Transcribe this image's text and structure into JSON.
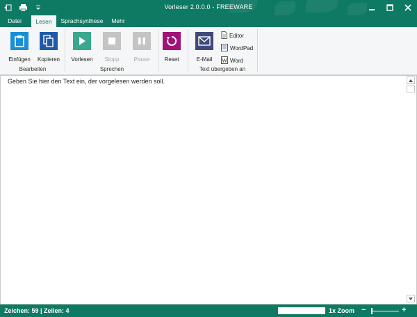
{
  "window": {
    "title": "Vorleser 2.0.0.0   -   FREEWARE",
    "minimize_icon": "minimize-icon",
    "maximize_icon": "maximize-icon",
    "close_icon": "close-icon"
  },
  "quick_access": [
    "back-icon",
    "printer-icon",
    "qat-dropdown-icon"
  ],
  "tabs": [
    {
      "label": "Datei",
      "active": false
    },
    {
      "label": "Lesen",
      "active": true
    },
    {
      "label": "Sprachsynthese",
      "active": false
    },
    {
      "label": "Mehr",
      "active": false
    }
  ],
  "ribbon": {
    "groups": {
      "bearbeiten": "Bearbeiten",
      "sprechen": "Sprechen",
      "uebergeben": "Text übergeben an"
    },
    "buttons": {
      "einfuegen": {
        "label": "Einfügen",
        "icon": "clipboard-icon",
        "color": "#1a8fd6"
      },
      "kopieren": {
        "label": "Kopieren",
        "icon": "copy-icon",
        "color": "#1f5aa8"
      },
      "vorlesen": {
        "label": "Vorlesen",
        "icon": "play-icon",
        "color": "#3aa88c"
      },
      "stopp": {
        "label": "Stopp",
        "icon": "stop-icon",
        "color": "#c4c4c4",
        "disabled": true
      },
      "pause": {
        "label": "Pause",
        "icon": "pause-icon",
        "color": "#c4c4c4",
        "disabled": true
      },
      "reset": {
        "label": "Reset",
        "icon": "reset-icon",
        "color": "#a0127a"
      },
      "email": {
        "label": "E-Mail",
        "icon": "envelope-icon",
        "color": "#3f4a7a"
      }
    },
    "small_buttons": {
      "editor": {
        "label": "Editor",
        "icon": "document-icon"
      },
      "wordpad": {
        "label": "WordPad",
        "icon": "wordpad-icon"
      },
      "word": {
        "label": "Word",
        "icon": "word-icon"
      }
    }
  },
  "editor": {
    "text": "Geben Sie hier den Text ein, der vorgelesen werden soll."
  },
  "status": {
    "text": "Zeichen:  59 | Zeilen:  4",
    "zoom": "1x Zoom",
    "zoom_minus": "−",
    "zoom_plus": "+"
  },
  "colors": {
    "accent": "#0f7a63",
    "ribbon_bg": "#f5f6f7"
  }
}
